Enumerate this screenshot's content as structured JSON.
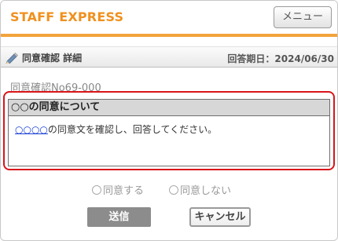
{
  "header": {
    "brand": "STAFF EXPRESS",
    "menu_label": "メニュー"
  },
  "subbar": {
    "title": "同意確認 詳細",
    "due_label": "回答期日：2024/06/30",
    "icon": "pencil-icon"
  },
  "document": {
    "number": "同意確認No69-000"
  },
  "consent": {
    "heading": "○○の同意について",
    "link_text": "○○○○",
    "body_text": "の同意文を確認し、回答してください。"
  },
  "options": {
    "agree": "同意する",
    "disagree": "同意しない"
  },
  "actions": {
    "send": "送信",
    "cancel": "キャンセル"
  },
  "colors": {
    "brand": "#f0901e",
    "accent_bar": "#f3a33b",
    "highlight": "#d9141a",
    "link": "#1a3fd6"
  }
}
